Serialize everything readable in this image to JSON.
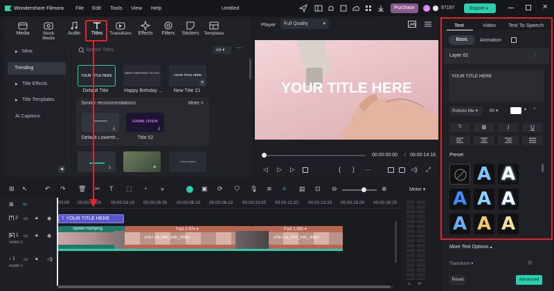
{
  "app": {
    "name": "Wondershare Filmora",
    "menu": [
      "File",
      "Edit",
      "Tools",
      "View",
      "Help"
    ],
    "project": "Untitled",
    "purchase": "Purchase",
    "credits": "97197",
    "export": "Export"
  },
  "media_tabs": [
    {
      "label": "Media",
      "icon": "media-icon"
    },
    {
      "label": "Stock Media",
      "icon": "stock-media-icon"
    },
    {
      "label": "Audio",
      "icon": "audio-icon"
    },
    {
      "label": "Titles",
      "icon": "titles-icon"
    },
    {
      "label": "Transitions",
      "icon": "transitions-icon"
    },
    {
      "label": "Effects",
      "icon": "effects-icon"
    },
    {
      "label": "Filters",
      "icon": "filters-icon"
    },
    {
      "label": "Stickers",
      "icon": "stickers-icon"
    },
    {
      "label": "Templates",
      "icon": "templates-icon"
    }
  ],
  "sidebar": {
    "items": [
      "Mine",
      "Trending",
      "Title Effects",
      "Title Templates",
      "AI Captions"
    ],
    "selected": "Trending"
  },
  "browser": {
    "search_placeholder": "Search Titles",
    "filter": "All",
    "row1": [
      {
        "label": "Default Title",
        "thumb_text": "YOUR TITLE HERE"
      },
      {
        "label": "Happy Birthday ...",
        "thumb_text": "HAPPY BIRTHDAY TO YOU"
      },
      {
        "label": "New Title 21",
        "thumb_text": "YOUR TITLE HERE"
      }
    ],
    "similar_header": "Similar recommendations",
    "more": "More >",
    "row2": [
      {
        "label": "Default Lowerth...",
        "thumb_text": ""
      },
      {
        "label": "Title 02",
        "thumb_text": "GAME OVER"
      }
    ],
    "row3_thumb_text": "Lorem ipsum"
  },
  "player": {
    "label": "Player",
    "quality": "Full Quality",
    "overlay_title": "YOUR TITLE HERE",
    "current_time": "00:00:00:00",
    "separator": "/",
    "total_time": "00:00:14:16"
  },
  "right_panel": {
    "tabs": [
      "Text",
      "Video",
      "Text To Speech"
    ],
    "active_tab": "Text",
    "subtabs": [
      "Basic",
      "Animation"
    ],
    "active_subtab": "Basic",
    "layer": "Layer 01",
    "text_value": "YOUR TITLE HERE",
    "font": "Roboto Me",
    "font_size": "80",
    "style_buttons": [
      "Tt",
      "B",
      "I",
      "U"
    ],
    "preset_label": "Preset",
    "more_options": "More Text Options",
    "transform": "Transform",
    "reset": "Reset",
    "advanced": "Advanced"
  },
  "timeline": {
    "ruler": [
      "00:00",
      "00:00:01:20",
      "00:00:03:10",
      "00:00:05:00",
      "00:00:06:20",
      "00:00:08:10",
      "00:00:10:00",
      "00:00:11:20",
      "00:00:13:10",
      "00:00:15:00",
      "00:00:16:20"
    ],
    "title_clip": "YOUR TITLE HERE",
    "speed_label": "Speed Ramping",
    "fast1": "Fast 2.57x",
    "fast2": "Fast 1.95x",
    "clip_name": "2087-sa_960_540_30fps",
    "clip_name2": "2087-sa_960_540_30fps",
    "tracks": [
      {
        "num": "2",
        "name": ""
      },
      {
        "num": "1",
        "name": "Video 1"
      },
      {
        "num": "1",
        "name": "Audio 1"
      }
    ],
    "meter": "Meter",
    "meter_lr": [
      "L",
      "R"
    ]
  },
  "colors": {
    "accent": "#28d4b0",
    "red_box": "#e5232a",
    "purple": "#5b56c9",
    "clip_teal": "#1f7a6a"
  }
}
